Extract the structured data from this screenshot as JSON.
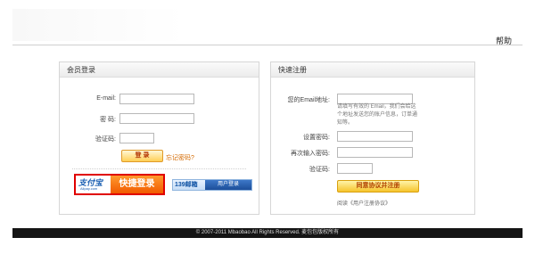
{
  "header": {
    "help": "帮助"
  },
  "login": {
    "title": "会员登录",
    "email_label": "E-mail:",
    "password_label": "密 码:",
    "captcha_label": "验证码:",
    "login_button": "登 录",
    "forgot_link": "忘记密码?",
    "alipay": {
      "brand": "支付宝",
      "domain": "Alipay.com",
      "text": "快捷登录"
    },
    "mail139": {
      "brand": "139邮箱",
      "text": "用户登录"
    }
  },
  "register": {
    "title": "快速注册",
    "email_label": "您的Email地址:",
    "email_hint": "请填写有效的 Email，我们会给这个地址发送您的账户信息，订单通知等。",
    "password_label": "设置密码:",
    "confirm_label": "再次输入密码:",
    "captcha_label": "验证码:",
    "submit_button": "同意协议并注册",
    "agreement_link": "阅读《用户注册协议》"
  },
  "footer": {
    "copyright": "© 2007-2011 Mbaobao All Rights Reserved. 麦包包版权所有"
  }
}
